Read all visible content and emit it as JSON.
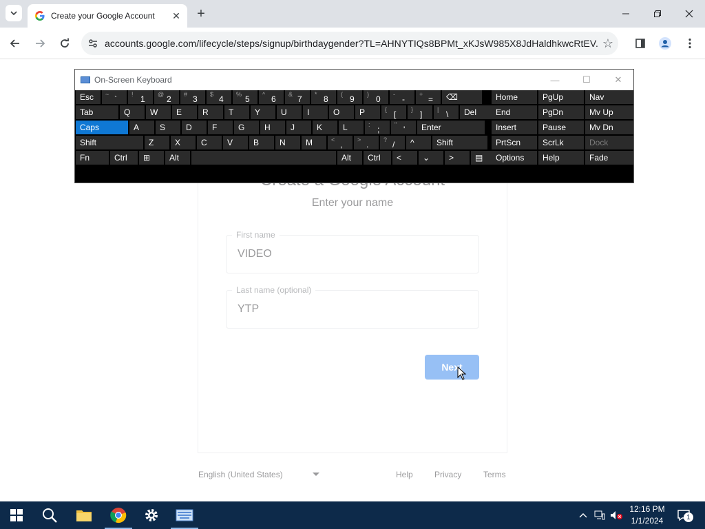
{
  "browser": {
    "tab": {
      "title": "Create your Google Account"
    },
    "url": "accounts.google.com/lifecycle/steps/signup/birthdaygender?TL=AHNYTIQs8BPMt_xKJsW985X8JdHaldhkwcRtEV..."
  },
  "page": {
    "title": "Create a Google Account",
    "subtitle": "Enter your name",
    "first_name": {
      "label": "First name",
      "value": "VIDEO"
    },
    "last_name": {
      "label": "Last name (optional)",
      "value": "YTP"
    },
    "next_label": "Next",
    "footer": {
      "language": "English (United States)",
      "links": [
        "Help",
        "Privacy",
        "Terms"
      ]
    }
  },
  "osk": {
    "title": "On-Screen Keyboard",
    "rows": [
      [
        "Esc",
        "~ `",
        "! 1",
        "@ 2",
        "# 3",
        "$ 4",
        "% 5",
        "^ 6",
        "& 7",
        "* 8",
        "( 9",
        ") 0",
        "- -",
        "+ =",
        "⌫"
      ],
      [
        "Tab",
        "Q",
        "W",
        "E",
        "R",
        "T",
        "Y",
        "U",
        "I",
        "O",
        "P",
        "{ [",
        "} ]",
        "| \\",
        "Del"
      ],
      [
        "Caps",
        "A",
        "S",
        "D",
        "F",
        "G",
        "H",
        "J",
        "K",
        "L",
        ": ;",
        "\" '",
        "Enter"
      ],
      [
        "Shift",
        "Z",
        "X",
        "C",
        "V",
        "B",
        "N",
        "M",
        "< ,",
        "> .",
        "? /",
        "^",
        "Shift"
      ],
      [
        "Fn",
        "Ctrl",
        "⊞",
        "Alt",
        "",
        "Alt",
        "Ctrl",
        "<",
        "⌄",
        ">",
        "▤"
      ]
    ],
    "nav_cols": [
      [
        "Home",
        "End",
        "Insert",
        "PrtScn",
        "Options"
      ],
      [
        "PgUp",
        "PgDn",
        "Pause",
        "ScrLk",
        "Help"
      ],
      [
        "Nav",
        "Mv Up",
        "Mv Dn",
        "Dock",
        "Fade"
      ]
    ]
  },
  "taskbar": {
    "time": "12:16 PM",
    "date": "1/1/2024",
    "notification_count": "1"
  }
}
